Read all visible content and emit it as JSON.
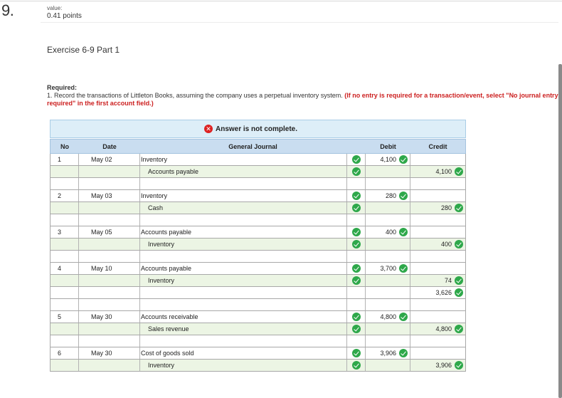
{
  "question": {
    "number": "9.",
    "value_label": "value:",
    "points": "0.41 points"
  },
  "exercise_title": "Exercise 6-9 Part 1",
  "required": {
    "heading": "Required:",
    "instruction": "1. Record the transactions of Littleton Books, assuming the company uses a perpetual inventory system.",
    "note": "(If no entry is required for a transaction/event, select \"No journal entry required\" in the first account field.)"
  },
  "status_banner": {
    "text": "Answer is not complete.",
    "status_color": "#dd2222"
  },
  "journal": {
    "headers": {
      "no": "No",
      "date": "Date",
      "general_journal": "General Journal",
      "debit": "Debit",
      "credit": "Credit"
    },
    "check_color": "#2ea84a",
    "entries": [
      {
        "no": "1",
        "date": "May 02",
        "lines": [
          {
            "account": "Inventory",
            "indent": false,
            "debit": "4,100",
            "credit": ""
          },
          {
            "account": "Accounts payable",
            "indent": true,
            "debit": "",
            "credit": "4,100"
          }
        ]
      },
      {
        "no": "2",
        "date": "May 03",
        "lines": [
          {
            "account": "Inventory",
            "indent": false,
            "debit": "280",
            "credit": ""
          },
          {
            "account": "Cash",
            "indent": true,
            "debit": "",
            "credit": "280"
          }
        ]
      },
      {
        "no": "3",
        "date": "May 05",
        "lines": [
          {
            "account": "Accounts payable",
            "indent": false,
            "debit": "400",
            "credit": ""
          },
          {
            "account": "Inventory",
            "indent": true,
            "debit": "",
            "credit": "400"
          }
        ]
      },
      {
        "no": "4",
        "date": "May 10",
        "lines": [
          {
            "account": "Accounts payable",
            "indent": false,
            "debit": "3,700",
            "credit": ""
          },
          {
            "account": "Inventory",
            "indent": true,
            "debit": "",
            "credit": "74"
          },
          {
            "account": "",
            "indent": true,
            "debit": "",
            "credit": "3,626",
            "no_check": true
          }
        ]
      },
      {
        "no": "5",
        "date": "May 30",
        "lines": [
          {
            "account": "Accounts receivable",
            "indent": false,
            "debit": "4,800",
            "credit": ""
          },
          {
            "account": "Sales revenue",
            "indent": true,
            "debit": "",
            "credit": "4,800"
          }
        ]
      },
      {
        "no": "6",
        "date": "May 30",
        "lines": [
          {
            "account": "Cost of goods sold",
            "indent": false,
            "debit": "3,906",
            "credit": ""
          },
          {
            "account": "Inventory",
            "indent": true,
            "debit": "",
            "credit": "3,906"
          }
        ]
      }
    ]
  }
}
